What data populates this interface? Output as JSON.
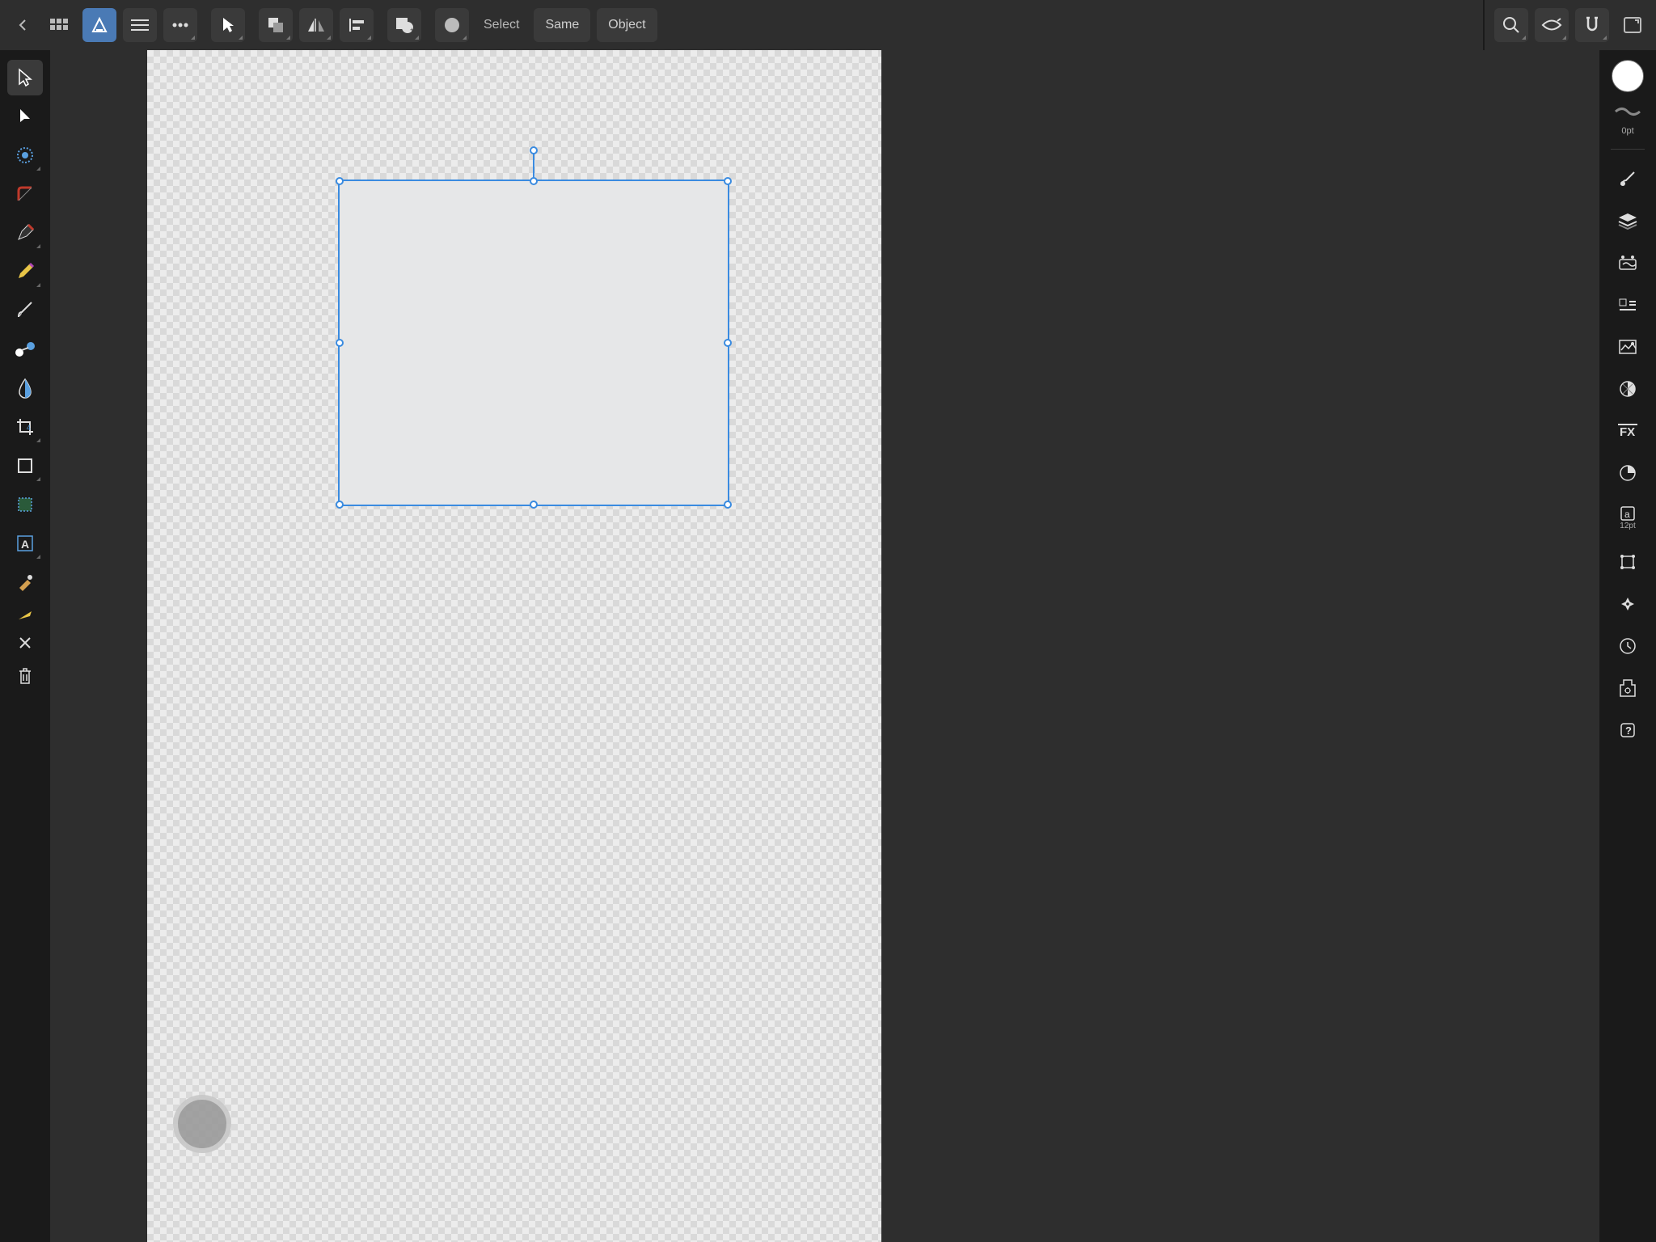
{
  "topbar": {
    "select_label": "Select",
    "same_label": "Same",
    "object_label": "Object"
  },
  "left_tools": [
    {
      "name": "move-tool",
      "active": true
    },
    {
      "name": "node-tool"
    },
    {
      "name": "point-transform-tool"
    },
    {
      "name": "corner-tool"
    },
    {
      "name": "pen-tool"
    },
    {
      "name": "pencil-tool"
    },
    {
      "name": "vector-brush-tool"
    },
    {
      "name": "fill-tool"
    },
    {
      "name": "transparency-tool"
    },
    {
      "name": "crop-tool"
    },
    {
      "name": "shape-tool"
    },
    {
      "name": "artboard-tool"
    },
    {
      "name": "text-tool"
    },
    {
      "name": "color-picker-tool"
    },
    {
      "name": "eraser-tool"
    }
  ],
  "rightbar": {
    "stroke_label": "0pt",
    "font_size": "12pt"
  },
  "selection": {
    "fill": "#e6e7e8",
    "stroke": "none"
  }
}
